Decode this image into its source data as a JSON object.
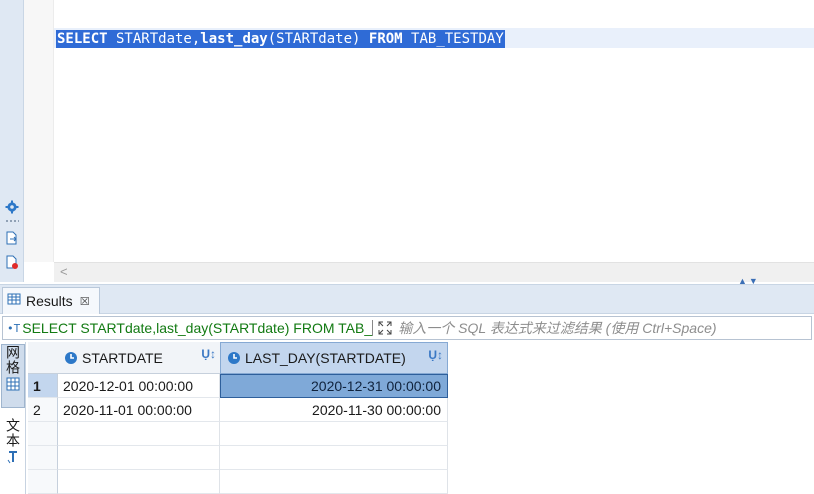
{
  "editor": {
    "sql_kw1": "SELECT",
    "sql_p1": " STARTdate,",
    "sql_kw2": "last_day",
    "sql_p2": "(STARTdate) ",
    "sql_kw3": "FROM",
    "sql_p3": " TAB_TESTDAY",
    "scroll_left": "<"
  },
  "results_tab": {
    "label": "Results",
    "close": "☒"
  },
  "filter": {
    "prefix": "•T",
    "query": "SELECT STARTdate,last_day(STARTdate) FROM TAB_TESTDAY",
    "placeholder": "输入一个 SQL 表达式来过滤结果 (使用 Ctrl+Space)"
  },
  "side_panel": {
    "grid_label": "网格",
    "text_label": "文本"
  },
  "grid": {
    "columns": [
      {
        "label": "STARTDATE",
        "sort_icon": "Ụ↕"
      },
      {
        "label": "LAST_DAY(STARTDATE)",
        "sort_icon": "Ụ↕"
      }
    ],
    "rows": [
      {
        "num": "1",
        "startdate": "2020-12-01 00:00:00",
        "last_day": "2020-12-31 00:00:00"
      },
      {
        "num": "2",
        "startdate": "2020-11-01 00:00:00",
        "last_day": "2020-11-30 00:00:00"
      }
    ]
  },
  "colors": {
    "selection": "#2f6bd6",
    "panel_bg": "#dfe8f3",
    "filter_query": "#127a12",
    "cell_selected": "#7fa9d8"
  }
}
